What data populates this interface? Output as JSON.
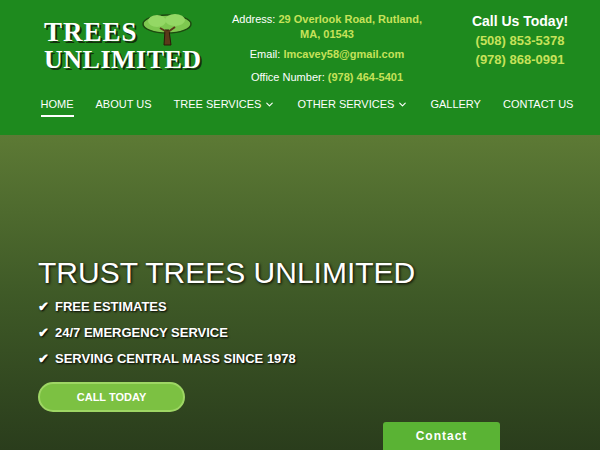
{
  "logo": {
    "line1": "TREES",
    "line2": "UNLIMITED"
  },
  "contact_info": {
    "address_label": "Address:",
    "address": "29 Overlook Road, Rutland, MA, 01543",
    "email_label": "Email:",
    "email": "lmcavey58@gmail.com",
    "office_label": "Office Number:",
    "office": "(978) 464-5401"
  },
  "call": {
    "title": "Call Us Today!",
    "phones": [
      "(508) 853-5378",
      "(978) 868-0991"
    ]
  },
  "nav": [
    {
      "label": "HOME",
      "selected": true,
      "dropdown": false
    },
    {
      "label": "ABOUT US",
      "selected": false,
      "dropdown": false
    },
    {
      "label": "TREE SERVICES",
      "selected": false,
      "dropdown": true
    },
    {
      "label": "OTHER SERVICES",
      "selected": false,
      "dropdown": true
    },
    {
      "label": "GALLERY",
      "selected": false,
      "dropdown": false
    },
    {
      "label": "CONTACT US",
      "selected": false,
      "dropdown": false
    }
  ],
  "hero": {
    "title": "TRUST TREES UNLIMITED",
    "features": [
      {
        "icon": "✔",
        "text": "FREE ESTIMATES"
      },
      {
        "icon": "✔",
        "text": "24/7 EMERGENCY SERVICE"
      },
      {
        "icon": "✔",
        "text": "SERVING CENTRAL MASS SINCE 1978"
      }
    ],
    "button": "CALL TODAY"
  },
  "contact_widget": {
    "label": "Contact"
  }
}
